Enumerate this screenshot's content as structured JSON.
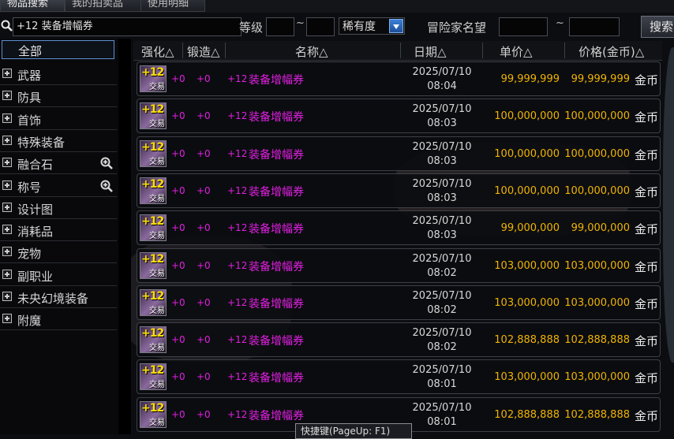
{
  "tabs": [
    {
      "label": "物品搜索",
      "active": true
    },
    {
      "label": "我的拍卖品",
      "active": false
    },
    {
      "label": "使用明细",
      "active": false
    }
  ],
  "search": {
    "value": "+12 装备增幅券",
    "level_label": "等级",
    "tilde": "~",
    "rarity_label": "稀有度",
    "adventurer_label": "冒险家名望",
    "button_label": "搜索"
  },
  "sidebar": {
    "items": [
      {
        "label": "全部",
        "selected": true,
        "zoom": false
      },
      {
        "label": "武器",
        "zoom": false
      },
      {
        "label": "防具",
        "zoom": false
      },
      {
        "label": "首饰",
        "zoom": false
      },
      {
        "label": "特殊装备",
        "zoom": false
      },
      {
        "label": "融合石",
        "zoom": true
      },
      {
        "label": "称号",
        "zoom": true
      },
      {
        "label": "设计图",
        "zoom": false
      },
      {
        "label": "消耗品",
        "zoom": false
      },
      {
        "label": "宠物",
        "zoom": false
      },
      {
        "label": "副职业",
        "zoom": false
      },
      {
        "label": "未央幻境装备",
        "zoom": false
      },
      {
        "label": "附魔",
        "zoom": false
      }
    ]
  },
  "table": {
    "headers": {
      "enhance": "强化△",
      "forge": "锻造△",
      "name": "名称△",
      "date": "日期△",
      "unit_price": "单价△",
      "total_price": "价格(金币)△"
    },
    "icon_text": "+12",
    "icon_trade": "交易",
    "rows": [
      {
        "enhance": "+0",
        "forge": "+0",
        "name_prefix": "+12",
        "name": "装备增幅券",
        "date": "2025/07/10",
        "time": "08:04",
        "unit_price": "99,999,999",
        "total_price": "99,999,999",
        "currency": "金币"
      },
      {
        "enhance": "+0",
        "forge": "+0",
        "name_prefix": "+12",
        "name": "装备增幅券",
        "date": "2025/07/10",
        "time": "08:03",
        "unit_price": "100,000,000",
        "total_price": "100,000,000",
        "currency": "金币"
      },
      {
        "enhance": "+0",
        "forge": "+0",
        "name_prefix": "+12",
        "name": "装备增幅券",
        "date": "2025/07/10",
        "time": "08:03",
        "unit_price": "100,000,000",
        "total_price": "100,000,000",
        "currency": "金币"
      },
      {
        "enhance": "+0",
        "forge": "+0",
        "name_prefix": "+12",
        "name": "装备增幅券",
        "date": "2025/07/10",
        "time": "08:03",
        "unit_price": "100,000,000",
        "total_price": "100,000,000",
        "currency": "金币"
      },
      {
        "enhance": "+0",
        "forge": "+0",
        "name_prefix": "+12",
        "name": "装备增幅券",
        "date": "2025/07/10",
        "time": "08:03",
        "unit_price": "99,000,000",
        "total_price": "99,000,000",
        "currency": "金币"
      },
      {
        "enhance": "+0",
        "forge": "+0",
        "name_prefix": "+12",
        "name": "装备增幅券",
        "date": "2025/07/10",
        "time": "08:02",
        "unit_price": "103,000,000",
        "total_price": "103,000,000",
        "currency": "金币"
      },
      {
        "enhance": "+0",
        "forge": "+0",
        "name_prefix": "+12",
        "name": "装备增幅券",
        "date": "2025/07/10",
        "time": "08:02",
        "unit_price": "103,000,000",
        "total_price": "103,000,000",
        "currency": "金币"
      },
      {
        "enhance": "+0",
        "forge": "+0",
        "name_prefix": "+12",
        "name": "装备增幅券",
        "date": "2025/07/10",
        "time": "08:02",
        "unit_price": "102,888,888",
        "total_price": "102,888,888",
        "currency": "金币"
      },
      {
        "enhance": "+0",
        "forge": "+0",
        "name_prefix": "+12",
        "name": "装备增幅券",
        "date": "2025/07/10",
        "time": "08:01",
        "unit_price": "103,000,000",
        "total_price": "103,000,000",
        "currency": "金币"
      },
      {
        "enhance": "+0",
        "forge": "+0",
        "name_prefix": "+12",
        "name": "装备增幅券",
        "date": "2025/07/10",
        "time": "08:01",
        "unit_price": "102,888,888",
        "total_price": "102,888,888",
        "currency": "金币"
      }
    ]
  },
  "tooltip": {
    "text": "快捷键(PageUp: F1)"
  },
  "colors": {
    "price": "#f0b400",
    "item_name": "#e020e0",
    "selection_border": "#5e8fd0"
  },
  "icons": {
    "search": "magnifier-icon",
    "zoom": "zoom-in-icon",
    "expand": "plus-box-icon",
    "dropdown": "chevron-down-icon"
  }
}
